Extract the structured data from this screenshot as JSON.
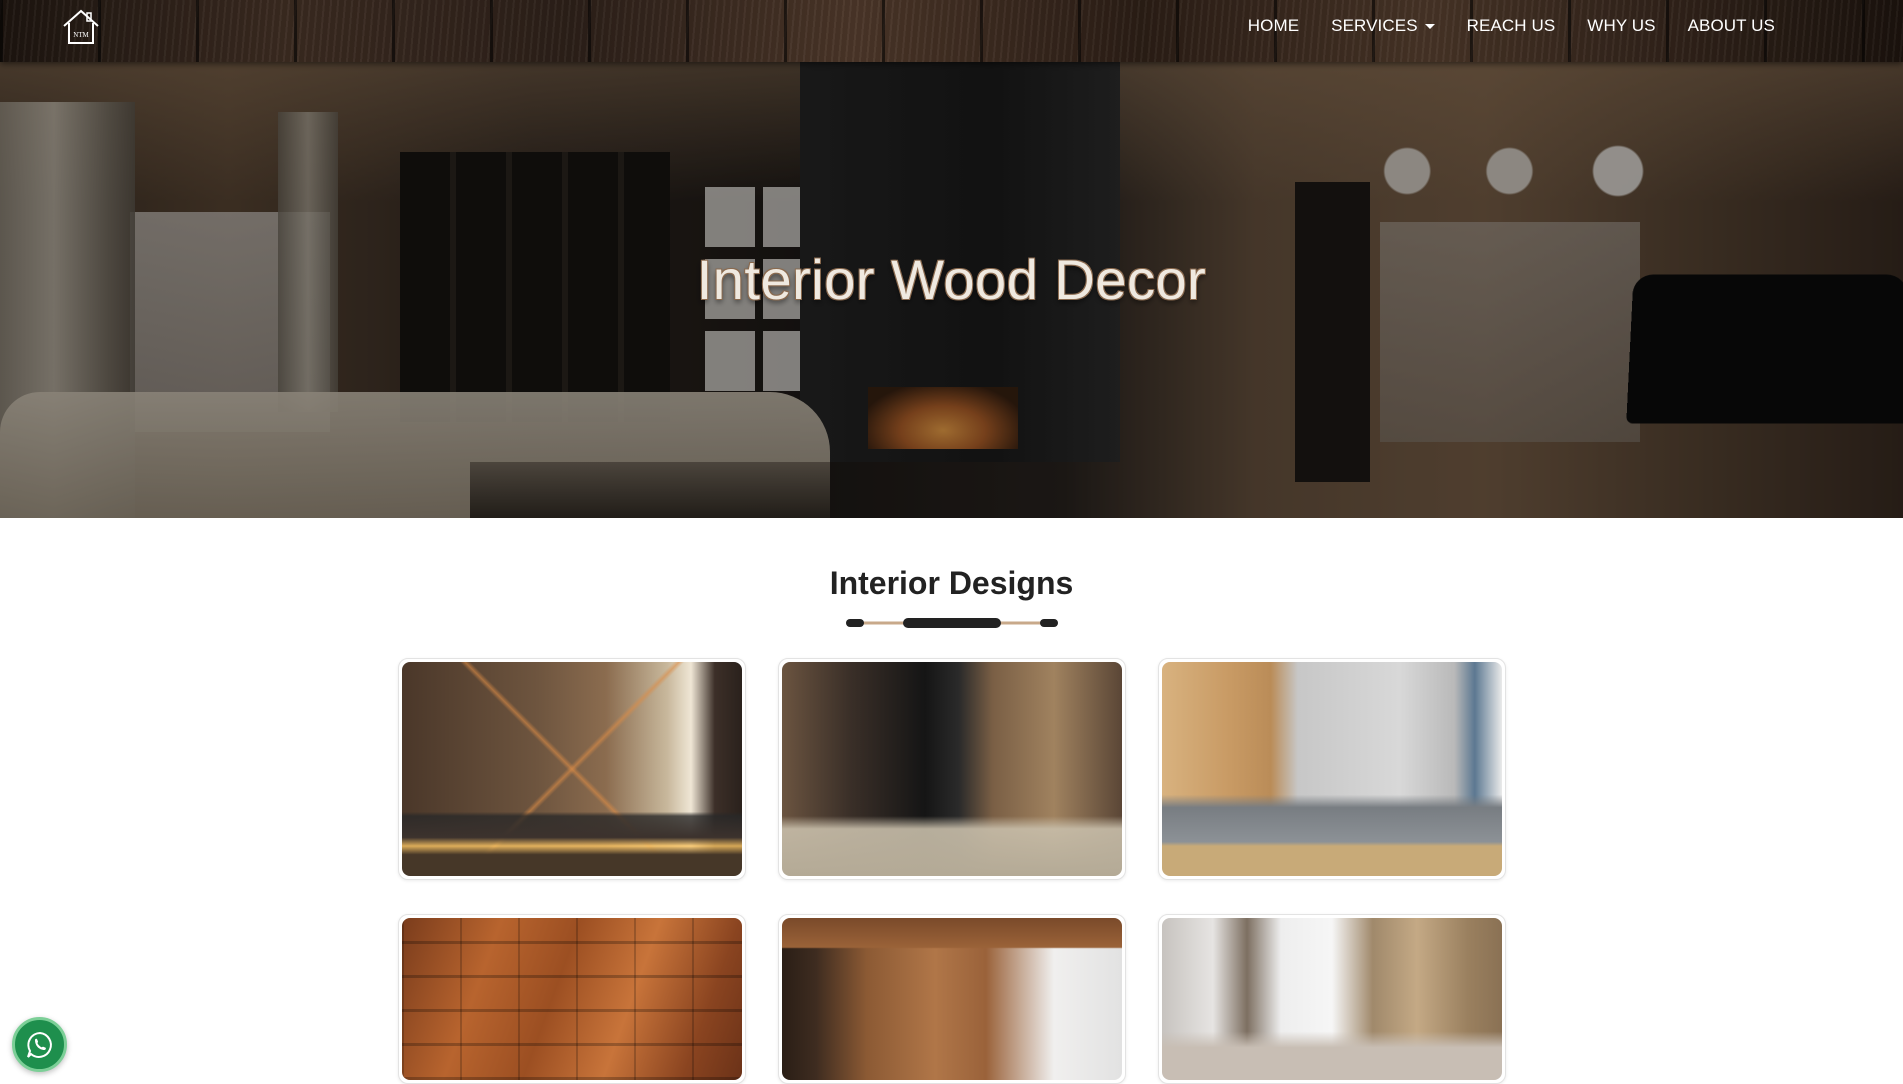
{
  "brand": {
    "logo_text": "NTM"
  },
  "nav": {
    "items": [
      {
        "label": "HOME"
      },
      {
        "label": "SERVICES",
        "has_dropdown": true
      },
      {
        "label": "REACH US"
      },
      {
        "label": "WHY US"
      },
      {
        "label": "ABOUT US"
      }
    ]
  },
  "hero": {
    "title": "Interior Wood Decor"
  },
  "section": {
    "title_bold": "Interior",
    "title_rest": "Designs"
  },
  "gallery": {
    "items": [
      {
        "icon": "bedroom-wood-wall-image"
      },
      {
        "icon": "living-room-fireplace-image"
      },
      {
        "icon": "living-room-wood-panel-image"
      },
      {
        "icon": "wood-block-wall-image"
      },
      {
        "icon": "tv-wall-wood-image"
      },
      {
        "icon": "living-room-stone-wall-image"
      }
    ]
  },
  "colors": {
    "nav_text": "#ffffff",
    "section_title": "#222222",
    "divider_dark": "#222222",
    "divider_tan": "#c8a98a",
    "whatsapp": "#1e8f4d"
  },
  "floating": {
    "icon": "whatsapp-icon"
  }
}
